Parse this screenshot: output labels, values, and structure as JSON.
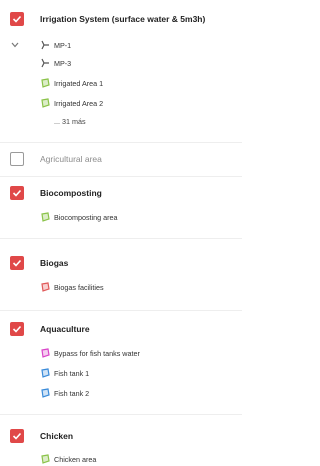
{
  "groups": [
    {
      "title": "Irrigation System (surface water & 5m3h)",
      "checked": true,
      "items": [
        {
          "label": "MP-1",
          "icon": "pipe-icon",
          "color": "#555555"
        },
        {
          "label": "MP-3",
          "icon": "pipe-icon",
          "color": "#555555"
        },
        {
          "label": "Irrigated Area 1",
          "icon": "polygon-icon",
          "color": "#8bc34a"
        },
        {
          "label": "Irrigated Area 2",
          "icon": "polygon-icon",
          "color": "#8bc34a"
        }
      ],
      "more": "... 31 más"
    },
    {
      "title": "Agricultural area",
      "checked": false,
      "items": []
    },
    {
      "title": "Biocomposting",
      "checked": true,
      "items": [
        {
          "label": "Biocomposting area",
          "icon": "polygon-icon",
          "color": "#8bc34a"
        }
      ]
    },
    {
      "title": "Biogas",
      "checked": true,
      "items": [
        {
          "label": "Biogas facilities",
          "icon": "polygon-icon",
          "color": "#e05a5a"
        }
      ]
    },
    {
      "title": "Aquaculture",
      "checked": true,
      "items": [
        {
          "label": "Bypass for fish tanks water",
          "icon": "polygon-icon",
          "color": "#d946c9"
        },
        {
          "label": "Fish tank 1",
          "icon": "polygon-icon",
          "color": "#3b8bd9"
        },
        {
          "label": "Fish tank 2",
          "icon": "polygon-icon",
          "color": "#3b8bd9"
        }
      ]
    },
    {
      "title": "Chicken",
      "checked": true,
      "items": [
        {
          "label": "Chicken area",
          "icon": "polygon-icon",
          "color": "#8bc34a"
        }
      ]
    }
  ],
  "colors": {
    "accent": "#e04848"
  }
}
